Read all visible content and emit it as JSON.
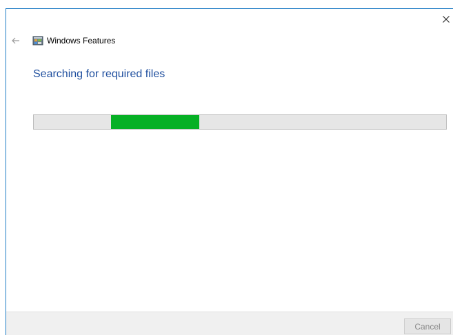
{
  "window": {
    "title": "Windows Features",
    "close_icon": "close-icon",
    "back_icon": "back-arrow-icon",
    "app_icon": "windows-features-icon",
    "accent_color": "#1b7ac4"
  },
  "main": {
    "heading": "Searching for required files",
    "heading_color": "#1e4e9e",
    "progress": {
      "state": "indeterminate",
      "fill_color": "#06b025",
      "track_color": "#e6e6e6"
    }
  },
  "footer": {
    "cancel_label": "Cancel"
  }
}
